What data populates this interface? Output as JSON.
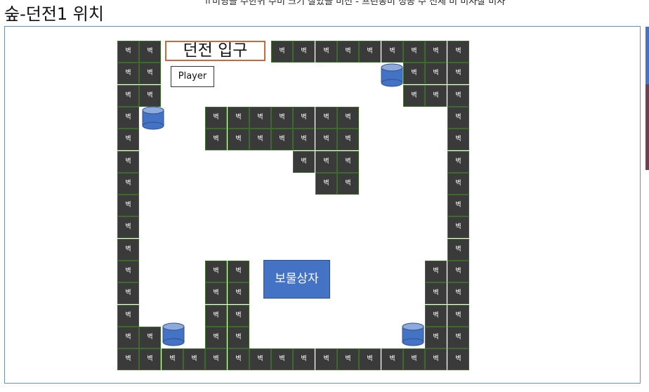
{
  "header": {
    "title": "숲-던전1 위치",
    "top_text": "ㅠ미영을 주한귀 주미 크기 잘았을 미선 - 프린동미 성공 주 선세 미 미사잘 미사"
  },
  "map": {
    "wall_label": "벽",
    "entrance_label": "던전 입구",
    "player_label": "Player",
    "chest_label": "보물상자",
    "colors": {
      "wall_fill": "#3a3a3a",
      "wall_border": "#3c6a2b",
      "chest_fill": "#4472c4",
      "barrel_fill": "#4472c4",
      "entrance_border": "#c56b3c",
      "frame_border": "#6f8fb6"
    },
    "barrel_icon": "cylinder-barrel-icon"
  }
}
